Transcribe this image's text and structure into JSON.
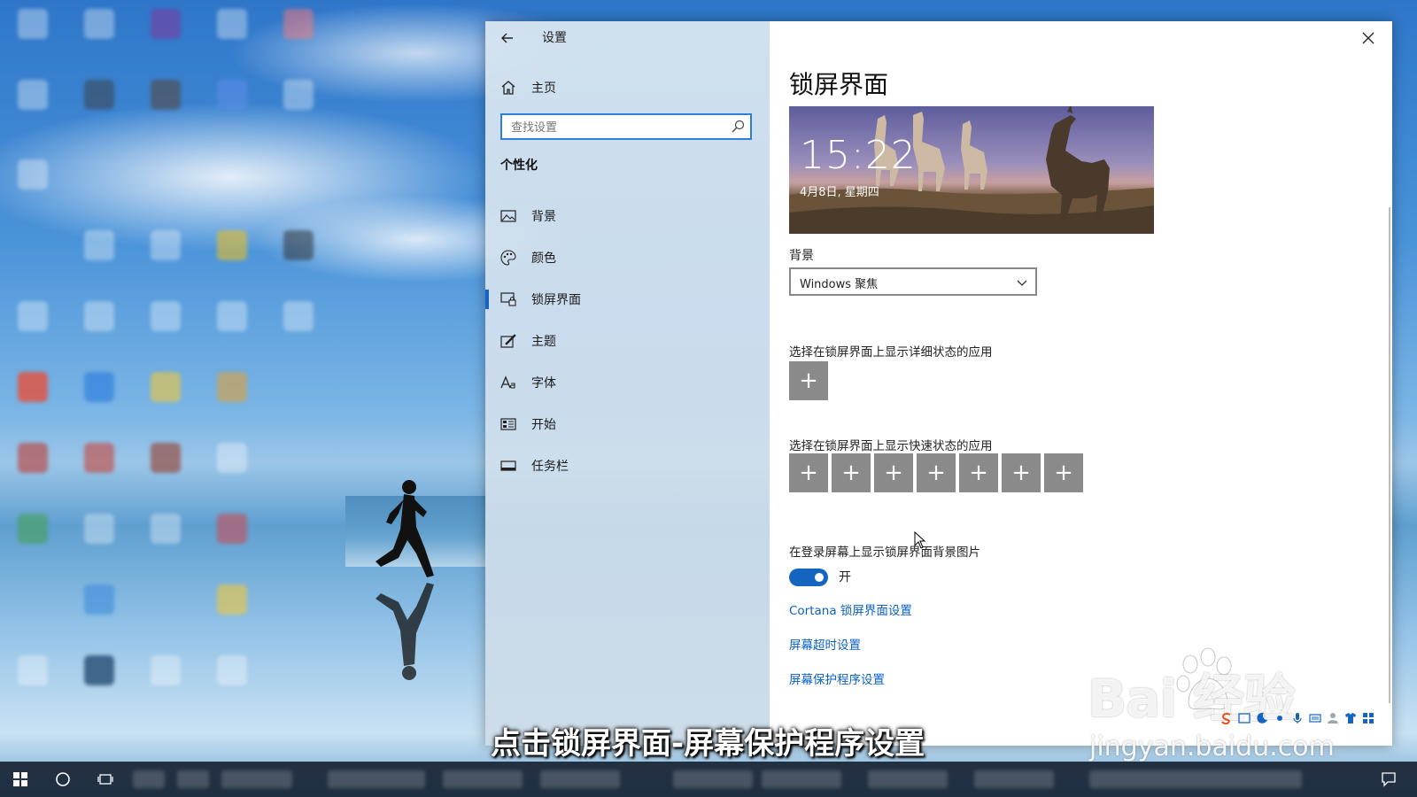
{
  "window": {
    "title": "设置",
    "back_label": "←",
    "close_label": "✕"
  },
  "nav": {
    "home_label": "主页",
    "search_placeholder": "查找设置",
    "section_title": "个性化",
    "items": [
      {
        "label": "背景",
        "icon": "image-icon"
      },
      {
        "label": "颜色",
        "icon": "palette-icon"
      },
      {
        "label": "锁屏界面",
        "icon": "lock-screen-icon",
        "selected": true
      },
      {
        "label": "主题",
        "icon": "theme-brush-icon"
      },
      {
        "label": "字体",
        "icon": "font-icon"
      },
      {
        "label": "开始",
        "icon": "start-menu-icon"
      },
      {
        "label": "任务栏",
        "icon": "taskbar-icon"
      }
    ]
  },
  "content": {
    "page_title": "锁屏界面",
    "preview": {
      "time": "15:22",
      "date": "4月8日, 星期四"
    },
    "background_label": "背景",
    "background_value": "Windows 聚焦",
    "detail_app_label": "选择在锁屏界面上显示详细状态的应用",
    "plus_symbol": "+",
    "quick_app_label": "选择在锁屏界面上显示快速状态的应用",
    "quick_app_count": 7,
    "login_bg_label": "在登录屏幕上显示锁屏界面背景图片",
    "toggle_state": "开",
    "links": [
      "Cortana 锁屏界面设置",
      "屏幕超时设置",
      "屏幕保护程序设置"
    ]
  },
  "overlay": {
    "subtitle": "点击锁屏界面-屏幕保护程序设置",
    "watermark_main": "Bai  经验",
    "watermark_url": "jingyan.baidu.com"
  },
  "colors": {
    "accent": "#1565c0",
    "link": "#0b62c4",
    "plus_button": "#8a8a8a"
  }
}
